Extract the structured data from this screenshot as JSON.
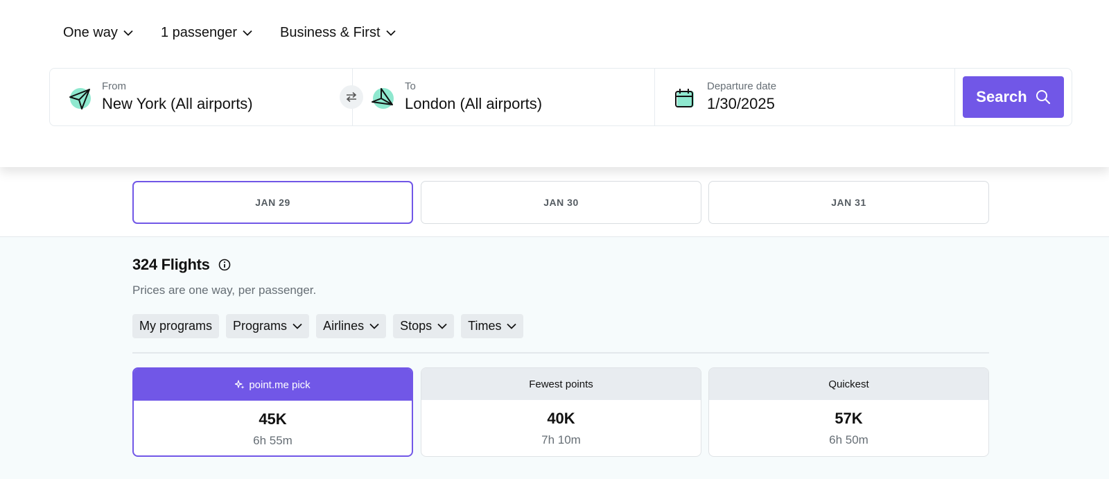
{
  "options": {
    "trip_type": "One way",
    "passengers": "1 passenger",
    "cabin": "Business & First"
  },
  "search": {
    "from_label": "From",
    "from_value": "New York (All airports)",
    "to_label": "To",
    "to_value": "London (All airports)",
    "date_label": "Departure date",
    "date_value": "1/30/2025",
    "button_label": "Search"
  },
  "date_tabs": [
    {
      "label": "JAN 29",
      "selected": true
    },
    {
      "label": "JAN 30",
      "selected": false
    },
    {
      "label": "JAN 31",
      "selected": false
    }
  ],
  "results": {
    "count_title": "324 Flights",
    "subtitle": "Prices are one way, per passenger."
  },
  "filters": [
    {
      "label": "My programs"
    },
    {
      "label": "Programs"
    },
    {
      "label": "Airlines"
    },
    {
      "label": "Stops"
    },
    {
      "label": "Times"
    }
  ],
  "summary_cards": [
    {
      "header": "point.me pick",
      "points": "45K",
      "duration": "6h 55m",
      "selected": true
    },
    {
      "header": "Fewest points",
      "points": "40K",
      "duration": "7h 10m",
      "selected": false
    },
    {
      "header": "Quickest",
      "points": "57K",
      "duration": "6h 50m",
      "selected": false
    }
  ],
  "colors": {
    "accent": "#7157e7",
    "icon_mint": "#8fe8cf"
  }
}
